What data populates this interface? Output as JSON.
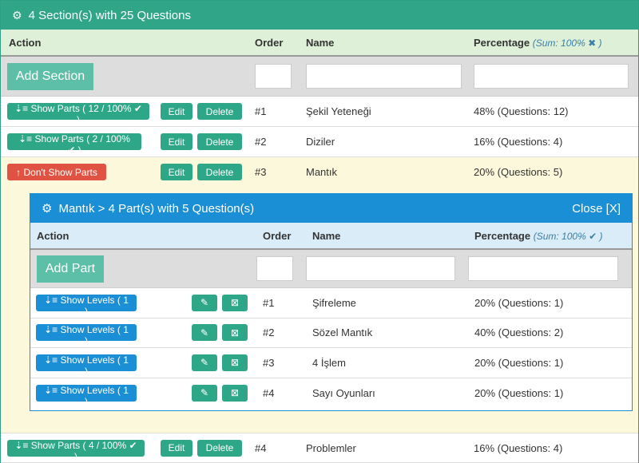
{
  "header": {
    "title": "4 Section(s) with 25 Questions"
  },
  "columns": {
    "action": "Action",
    "order": "Order",
    "name": "Name",
    "percentage": "Percentage",
    "sum": "(Sum: 100%",
    "sum_close": ")"
  },
  "add_section": "Add Section",
  "sections": [
    {
      "toggle": "Show Parts ( 12 / 100%",
      "edit": "Edit",
      "delete": "Delete",
      "order": "#1",
      "name": "Şekil Yeteneği",
      "pct": "48% (Questions: 12)"
    },
    {
      "toggle": "Show Parts ( 2 / 100%",
      "edit": "Edit",
      "delete": "Delete",
      "order": "#2",
      "name": "Diziler",
      "pct": "16% (Questions: 4)"
    },
    {
      "toggle": "Don't Show Parts",
      "edit": "Edit",
      "delete": "Delete",
      "order": "#3",
      "name": "Mantık",
      "pct": "20% (Questions: 5)"
    },
    {
      "toggle": "Show Parts ( 4 / 100%",
      "edit": "Edit",
      "delete": "Delete",
      "order": "#4",
      "name": "Problemler",
      "pct": "16% (Questions: 4)"
    }
  ],
  "panel": {
    "title": "Mantık > 4 Part(s) with 5 Question(s)",
    "close": "Close [X]",
    "add_part": "Add Part",
    "parts": [
      {
        "toggle": "Show Levels ( 1 )",
        "order": "#1",
        "name": "Şifreleme",
        "pct": "20% (Questions: 1)"
      },
      {
        "toggle": "Show Levels ( 1 )",
        "order": "#2",
        "name": "Sözel Mantık",
        "pct": "40% (Questions: 2)"
      },
      {
        "toggle": "Show Levels ( 1 )",
        "order": "#3",
        "name": "4 İşlem",
        "pct": "20% (Questions: 1)"
      },
      {
        "toggle": "Show Levels ( 1 )",
        "order": "#4",
        "name": "Sayı Oyunları",
        "pct": "20% (Questions: 1)"
      }
    ]
  },
  "colors": {
    "green": "#31a588",
    "blue": "#1a8fd6",
    "red": "#e05241",
    "yellow": "#fcf8dc"
  }
}
